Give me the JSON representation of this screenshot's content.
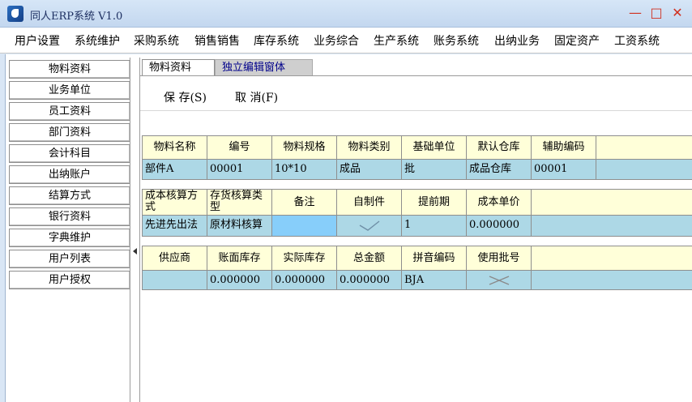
{
  "window": {
    "title": "同人ERP系统 V1.0",
    "minimize": "—",
    "maximize": "□",
    "close": "✕"
  },
  "menu": [
    "用户设置",
    "系统维护",
    "采购系统",
    "销售销售",
    "库存系统",
    "业务综合",
    "生产系统",
    "账务系统",
    "出纳业务",
    "固定资产",
    "工资系统"
  ],
  "sidebar": [
    "物料资料",
    "业务单位",
    "员工资料",
    "部门资料",
    "会计科目",
    "出纳账户",
    "结算方式",
    "银行资料",
    "字典维护",
    "用户列表",
    "用户授权"
  ],
  "tabs": [
    "物料资料",
    "独立编辑窗体"
  ],
  "toolbar": {
    "save": "保 存(S)",
    "cancel": "取 消(F)"
  },
  "row1": {
    "headers": [
      "物料名称",
      "编号",
      "物料规格",
      "物料类别",
      "基础单位",
      "默认仓库",
      "辅助编码"
    ],
    "values": [
      "部件A",
      "00001",
      "10*10",
      "成品",
      "批",
      "成品仓库",
      "00001"
    ]
  },
  "row2": {
    "headers": [
      "成本核算方式",
      "存货核算类型",
      "备注",
      "自制件",
      "提前期",
      "成本单价"
    ],
    "values": [
      "先进先出法",
      "原材料核算",
      "",
      "",
      "1",
      "0.000000"
    ]
  },
  "row3": {
    "headers": [
      "供应商",
      "账面库存",
      "实际库存",
      "总金额",
      "拼音编码",
      "使用批号"
    ],
    "values": [
      "",
      "0.000000",
      "0.000000",
      "0.000000",
      "BJA",
      ""
    ]
  },
  "flags": {
    "self_made": "checked",
    "use_batch": "unchecked"
  }
}
